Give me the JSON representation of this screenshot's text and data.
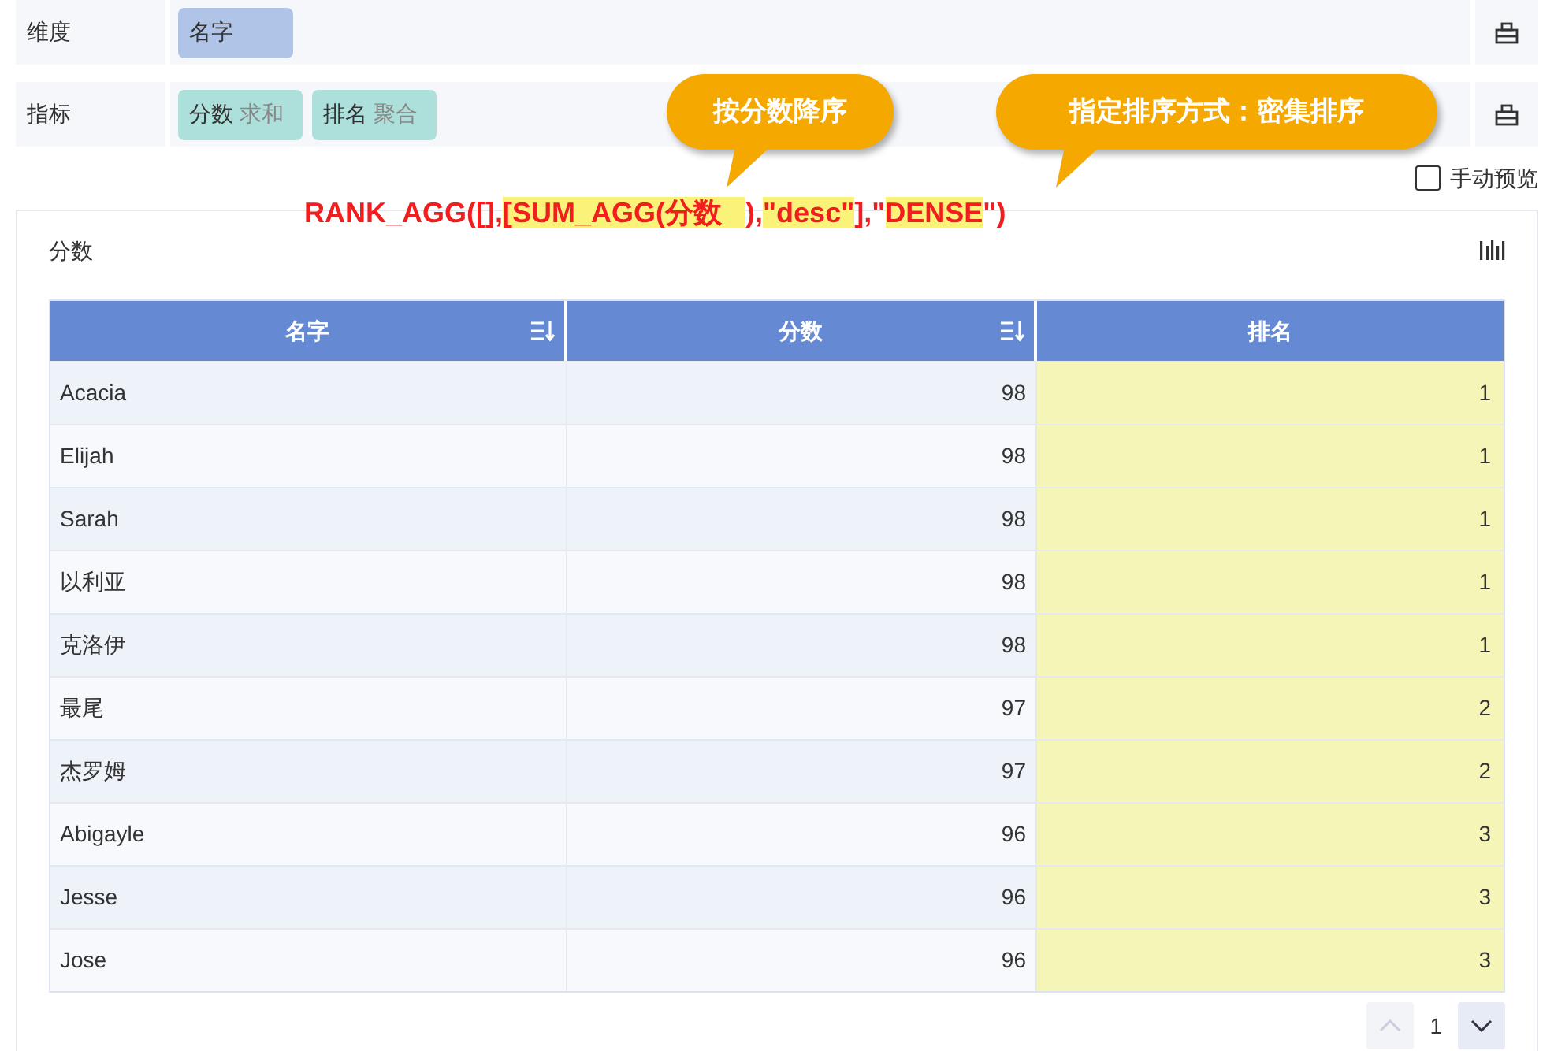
{
  "fields": [
    {
      "label": "维度",
      "pills": [
        {
          "text": "名字",
          "kind": "dimension"
        }
      ]
    },
    {
      "label": "指标",
      "pills": [
        {
          "text": "分数",
          "sub": "求和",
          "kind": "measure"
        },
        {
          "text": "排名",
          "sub": "聚合",
          "kind": "measure"
        }
      ]
    }
  ],
  "callouts": [
    "按分数降序",
    "指定排序方式：密集排序"
  ],
  "formula": [
    {
      "text": "RANK_AGG([],",
      "highlighted": false
    },
    {
      "text": "[SUM_AGG(分数   ",
      "highlighted": true
    },
    {
      "text": "),",
      "highlighted": false
    },
    {
      "text": "\"desc\"",
      "highlighted": true
    },
    {
      "text": "],\"",
      "highlighted": false
    },
    {
      "text": "DENSE",
      "highlighted": true
    },
    {
      "text": "\")",
      "highlighted": false
    }
  ],
  "manual_preview": {
    "label": "手动预览",
    "checked": false
  },
  "card": {
    "title": "分数",
    "table": {
      "columns": [
        {
          "label": "名字",
          "sortable": true,
          "highlighted": false
        },
        {
          "label": "分数",
          "sortable": true,
          "highlighted": false
        },
        {
          "label": "排名",
          "sortable": false,
          "highlighted": true
        }
      ],
      "rows": [
        [
          "Acacia",
          "98",
          "1"
        ],
        [
          "Elijah",
          "98",
          "1"
        ],
        [
          "Sarah",
          "98",
          "1"
        ],
        [
          "以利亚",
          "98",
          "1"
        ],
        [
          "克洛伊",
          "98",
          "1"
        ],
        [
          "最尾",
          "97",
          "2"
        ],
        [
          "杰罗姆",
          "97",
          "2"
        ],
        [
          "Abigayle",
          "96",
          "3"
        ],
        [
          "Jesse",
          "96",
          "3"
        ],
        [
          "Jose",
          "96",
          "3"
        ]
      ]
    },
    "page": "1"
  }
}
